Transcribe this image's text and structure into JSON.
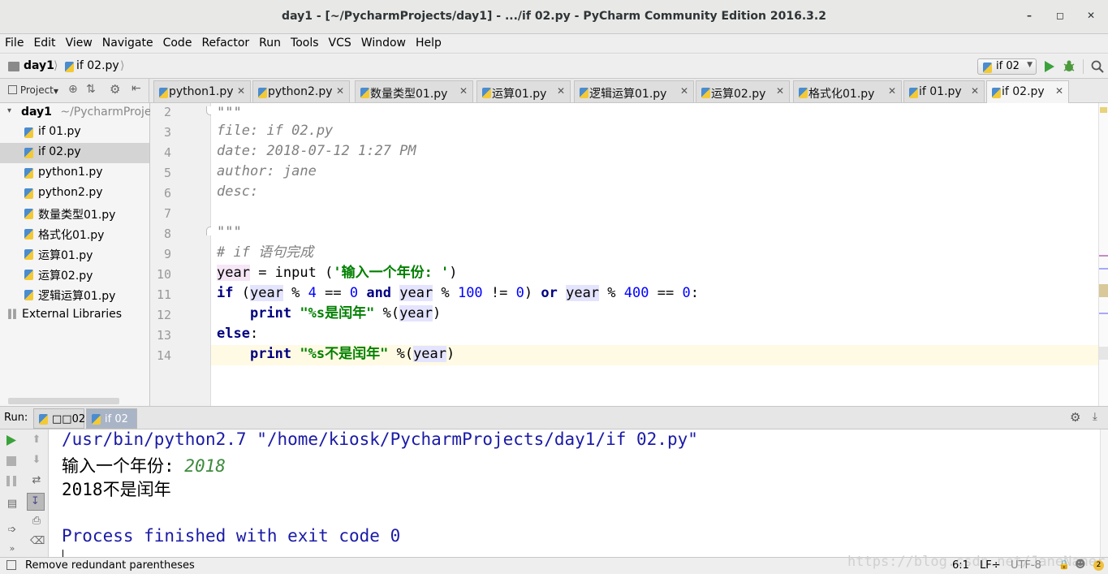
{
  "window": {
    "title": "day1 - [~/PycharmProjects/day1] - .../if 02.py - PyCharm Community Edition 2016.3.2"
  },
  "menu": [
    "File",
    "Edit",
    "View",
    "Navigate",
    "Code",
    "Refactor",
    "Run",
    "Tools",
    "VCS",
    "Window",
    "Help"
  ],
  "breadcrumb": {
    "project": "day1",
    "file": "if 02.py"
  },
  "run_config": "if 02",
  "project_panel": {
    "label": "Project"
  },
  "tabs": [
    "python1.py",
    "python2.py",
    "数量类型01.py",
    "运算01.py",
    "逻辑运算01.py",
    "运算02.py",
    "格式化01.py",
    "if 01.py",
    "if 02.py"
  ],
  "tree": {
    "root": "day1",
    "root_path": "~/PycharmProject",
    "files": [
      "if 01.py",
      "if 02.py",
      "python1.py",
      "python2.py",
      "数量类型01.py",
      "格式化01.py",
      "运算01.py",
      "运算02.py",
      "逻辑运算01.py"
    ],
    "external": "External Libraries"
  },
  "line_numbers": [
    "2",
    "3",
    "4",
    "5",
    "6",
    "7",
    "8",
    "9",
    "10",
    "11",
    "12",
    "13",
    "14"
  ],
  "code": {
    "l2": "\"\"\"",
    "l3": "file: if 02.py",
    "l4": "date: 2018-07-12 1:27 PM",
    "l5": "author: jane",
    "l6": "desc:",
    "l8": "\"\"\"",
    "l9": "# if 语句完成",
    "l10": {
      "var": "year",
      "eq": " = ",
      "fn": "input",
      "open": " (",
      "str": "'输入一个年份: '",
      "close": ")"
    },
    "l11": {
      "kw_if": "if",
      "p1": " (",
      "v1": "year",
      "o1": " % ",
      "n1": "4",
      "o2": " == ",
      "n2": "0",
      "kw_and": " and ",
      "v2": "year",
      "o3": " % ",
      "n3": "100",
      "o4": " != ",
      "n4": "0",
      "p2": ") ",
      "kw_or": "or",
      "sp": " ",
      "v3": "year",
      "o5": " % ",
      "n5": "400",
      "o6": " == ",
      "n6": "0",
      "colon": ":"
    },
    "l12": {
      "indent": "    ",
      "kw": "print",
      "sp": " ",
      "str": "\"%s是闰年\"",
      "op": " %(",
      "var": "year",
      "close": ")"
    },
    "l13": {
      "kw": "else",
      "colon": ":"
    },
    "l14": {
      "indent": "    ",
      "kw": "print",
      "sp": " ",
      "str": "\"%s不是闰年\"",
      "op": " %(",
      "var": "year",
      "close": ")"
    }
  },
  "run_panel": {
    "label": "Run:",
    "tabs": [
      "□□02",
      "if 02"
    ],
    "console": {
      "cmd": "/usr/bin/python2.7 \"/home/kiosk/PycharmProjects/day1/if 02.py\"",
      "prompt": "输入一个年份: ",
      "input": "2018",
      "output": "2018不是闰年",
      "finish": "Process finished with exit code 0"
    }
  },
  "status": {
    "message": "Remove redundant parentheses",
    "position": "6:1",
    "line_sep": "LF÷",
    "encoding": "UTF-8",
    "watermark": "https://blog.csdn.net/JaneNaner"
  },
  "colors": {
    "keyword": "#000080",
    "string": "#008000",
    "number": "#0000ff",
    "comment": "#808080",
    "console_blue": "#1a1aa6"
  }
}
